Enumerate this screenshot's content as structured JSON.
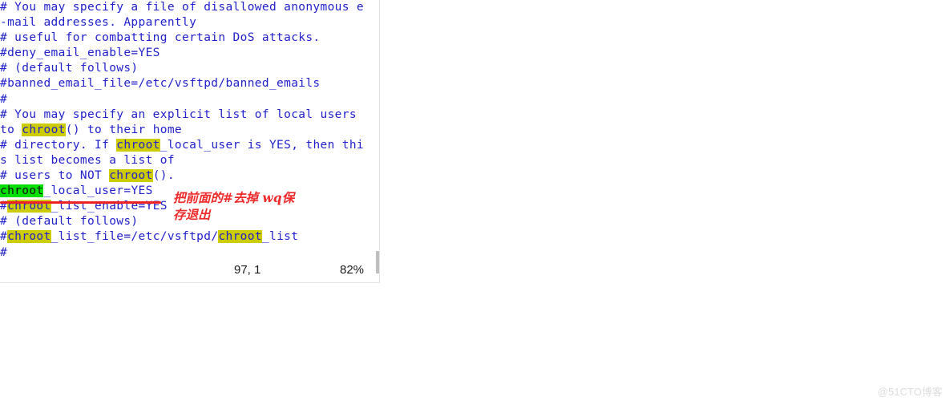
{
  "terminal": {
    "editor": "vim",
    "text_color": "#2222cc",
    "background": "#ffffff",
    "search_highlight_color": "#cccc00",
    "current_match_color": "#00e000",
    "lines": [
      {
        "id": "line-1",
        "text": "# You may specify a file of disallowed anonymous e"
      },
      {
        "id": "line-2",
        "text": "-mail addresses. Apparently"
      },
      {
        "id": "line-3",
        "text": "# useful for combatting certain DoS attacks."
      },
      {
        "id": "line-4",
        "text": "#deny_email_enable=YES"
      },
      {
        "id": "line-5",
        "text": "# (default follows)"
      },
      {
        "id": "line-6",
        "text": "#banned_email_file=/etc/vsftpd/banned_emails"
      },
      {
        "id": "line-7",
        "text": "#"
      },
      {
        "id": "line-8",
        "text": "# You may specify an explicit list of local users"
      },
      {
        "id": "line-9",
        "text": "to chroot() to their home"
      },
      {
        "id": "line-10",
        "text": "# directory. If chroot_local_user is YES, then thi"
      },
      {
        "id": "line-11",
        "text": "s list becomes a list of"
      },
      {
        "id": "line-12",
        "text": "# users to NOT chroot()."
      },
      {
        "id": "line-13",
        "text": "chroot_local_user=YES"
      },
      {
        "id": "line-14",
        "text": "#chroot_list_enable=YES"
      },
      {
        "id": "line-15",
        "text": "# (default follows)"
      },
      {
        "id": "line-16",
        "text": "#chroot_list_file=/etc/vsftpd/chroot_list"
      },
      {
        "id": "line-17",
        "text": "#"
      }
    ],
    "line_segments": {
      "line-9": [
        {
          "t": "to ",
          "h": "none"
        },
        {
          "t": "chroot",
          "h": "yellow"
        },
        {
          "t": "() to their home",
          "h": "none"
        }
      ],
      "line-10": [
        {
          "t": "# directory. If ",
          "h": "none"
        },
        {
          "t": "chroot",
          "h": "yellow"
        },
        {
          "t": "_local_user is YES, then thi",
          "h": "none"
        }
      ],
      "line-12": [
        {
          "t": "# users to NOT ",
          "h": "none"
        },
        {
          "t": "chroot",
          "h": "yellow"
        },
        {
          "t": "().",
          "h": "none"
        }
      ],
      "line-13": [
        {
          "t": "chroot",
          "h": "green"
        },
        {
          "t": "_local_user=YES",
          "h": "none"
        }
      ],
      "line-14": [
        {
          "t": "#",
          "h": "none"
        },
        {
          "t": "chroot",
          "h": "yellow"
        },
        {
          "t": "_list_enable=YES",
          "h": "none"
        }
      ],
      "line-16": [
        {
          "t": "#",
          "h": "none"
        },
        {
          "t": "chroot",
          "h": "yellow"
        },
        {
          "t": "_list_file=/etc/vsftpd/",
          "h": "none"
        },
        {
          "t": "chroot",
          "h": "yellow"
        },
        {
          "t": "_list",
          "h": "none"
        }
      ]
    }
  },
  "annotation": {
    "text": "把前面的#去掉 wq保\n存退出",
    "color": "#ee2a2a",
    "underline_color": "#ee2222"
  },
  "status_bar": {
    "position": "97, 1",
    "percent": "82%"
  },
  "scrollbar": {
    "thumb_color": "#bfbfbf"
  },
  "watermark": {
    "text": "@51CTO博客"
  }
}
